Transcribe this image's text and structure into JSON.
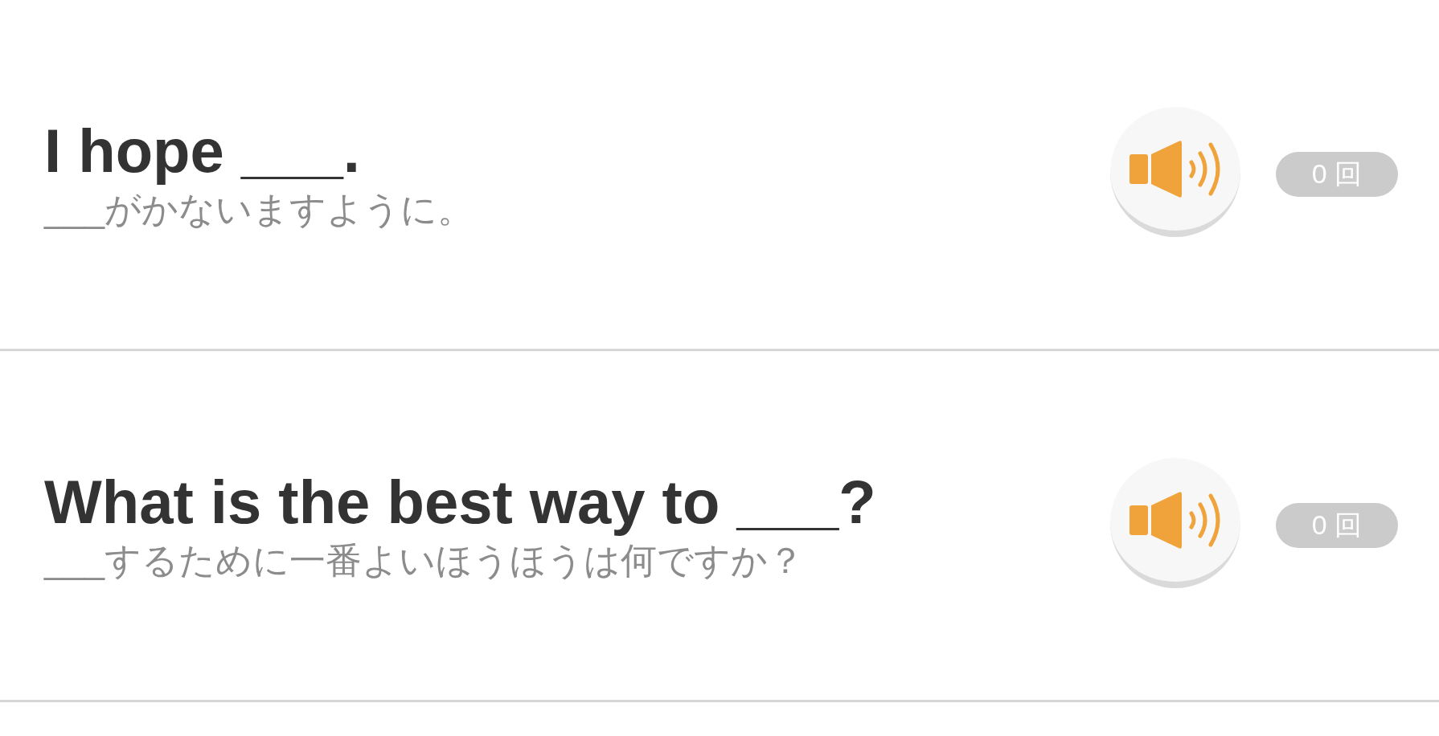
{
  "rows": [
    {
      "sentence": "I hope ___.",
      "translation": "___がかないますように。",
      "play_count": "0 回"
    },
    {
      "sentence": "What is the best way to ___?",
      "translation": "___するために一番よいほうほうは何ですか？",
      "play_count": "0 回"
    }
  ]
}
